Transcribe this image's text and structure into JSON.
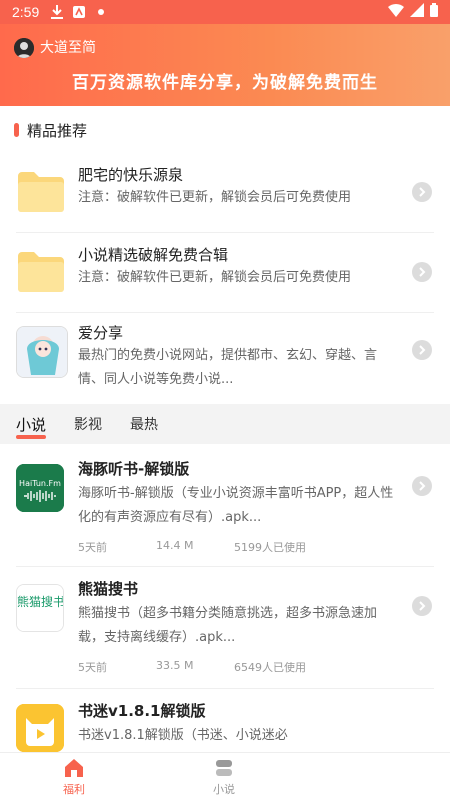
{
  "status": {
    "time": "2:59"
  },
  "header": {
    "username": "大道至简",
    "slogan": "百万资源软件库分享，为破解免费而生"
  },
  "section": {
    "title": "精品推荐"
  },
  "featured": [
    {
      "title": "肥宅的快乐源泉",
      "desc": "注意：破解软件已更新，解锁会员后可免费使用"
    },
    {
      "title": "小说精选破解免费合辑",
      "desc": "注意：破解软件已更新，解锁会员后可免费使用"
    },
    {
      "title": "爱分享",
      "desc": "最热门的免费小说网站，提供都市、玄幻、穿越、言情、同人小说等免费小说..."
    }
  ],
  "tabs": [
    "小说",
    "影视",
    "最热"
  ],
  "apps": [
    {
      "name": "海豚听书-解锁版",
      "icon_text": "HaiTun.Fm",
      "desc": "海豚听书-解锁版（专业小说资源丰富听书APP，超人性化的有声资源应有尽有）.apk...",
      "time": "5天前",
      "size": "14.4 M",
      "users": "5199人已使用"
    },
    {
      "name": "熊猫搜书",
      "icon_text": "熊猫搜书",
      "desc": "熊猫搜书（超多书籍分类随意挑选，超多书源急速加载，支持离线缓存）.apk...",
      "time": "5天前",
      "size": "33.5 M",
      "users": "6549人已使用"
    },
    {
      "name": "书迷v1.8.1解锁版",
      "desc": "书迷v1.8.1解锁版（书迷、小说迷必"
    }
  ],
  "nav": [
    {
      "label": "福利",
      "color": "#f7624d"
    },
    {
      "label": "小说",
      "color": "#999999"
    }
  ],
  "colors": {
    "accent": "#f7624d"
  }
}
